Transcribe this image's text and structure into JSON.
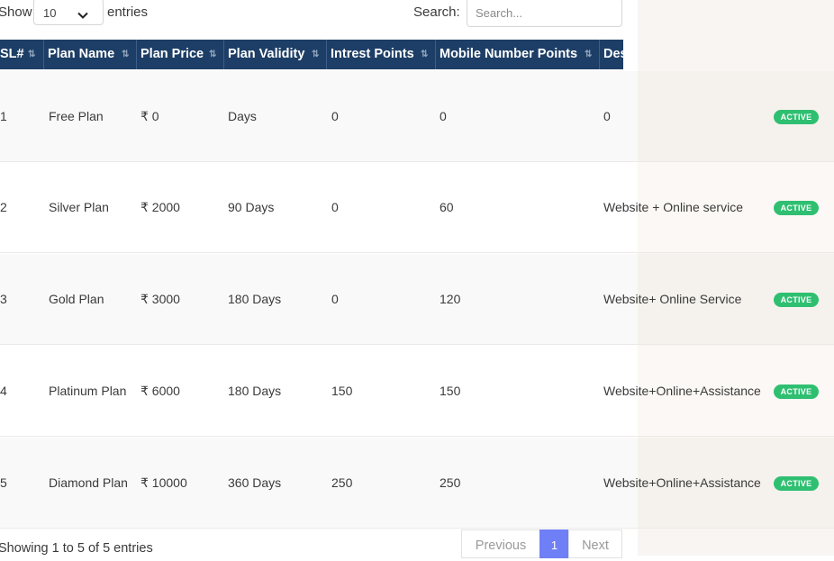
{
  "controls": {
    "show_label": "Show",
    "page_length": "10",
    "entries_label": "entries",
    "search_label": "Search:",
    "search_placeholder": "Search..."
  },
  "table": {
    "columns": [
      "SL#",
      "Plan Name",
      "Plan Price",
      "Plan Validity",
      "Intrest Points",
      "Mobile Number Points",
      "Des"
    ],
    "rows": [
      {
        "sl": "1",
        "name": "Free Plan",
        "price": "₹ 0",
        "validity": "Days",
        "interest": "0",
        "mobile": "0",
        "desc": "0",
        "status": "ACTIVE"
      },
      {
        "sl": "2",
        "name": "Silver Plan",
        "price": "₹ 2000",
        "validity": "90 Days",
        "interest": "0",
        "mobile": "60",
        "desc": "Website + Online service",
        "status": "ACTIVE"
      },
      {
        "sl": "3",
        "name": "Gold Plan",
        "price": "₹ 3000",
        "validity": "180 Days",
        "interest": "0",
        "mobile": "120",
        "desc": "Website+ Online Service",
        "status": "ACTIVE"
      },
      {
        "sl": "4",
        "name": "Platinum Plan",
        "price": "₹ 6000",
        "validity": "180 Days",
        "interest": "150",
        "mobile": "150",
        "desc": "Website+Online+Assistance",
        "status": "ACTIVE"
      },
      {
        "sl": "5",
        "name": "Diamond Plan",
        "price": "₹ 10000",
        "validity": "360 Days",
        "interest": "250",
        "mobile": "250",
        "desc": "Website+Online+Assistance",
        "status": "ACTIVE"
      }
    ]
  },
  "footer": {
    "info": "Showing 1 to 5 of 5 entries",
    "previous": "Previous",
    "current_page": "1",
    "next": "Next"
  },
  "colors": {
    "header_bg": "#1d3e66",
    "status_active": "#2fbf71",
    "pager_active": "#6f7ff5"
  },
  "icons": {
    "select_caret": "chevron-down-icon",
    "sort_indicator": "sort-arrows-icon"
  }
}
